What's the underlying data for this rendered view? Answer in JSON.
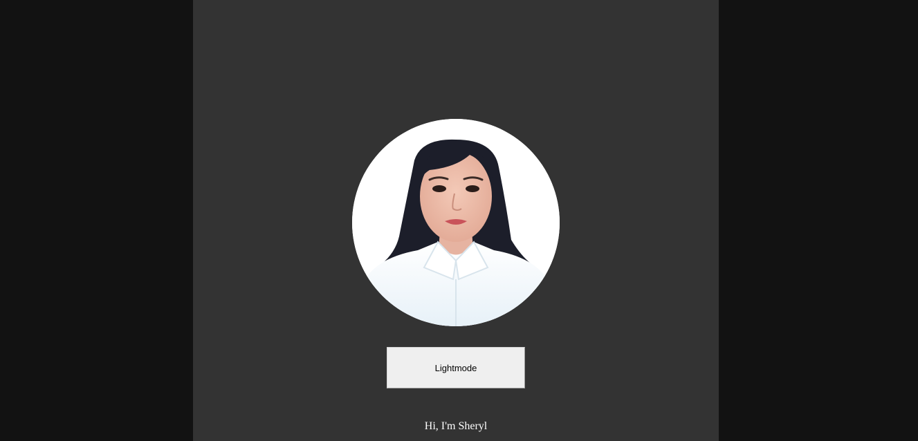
{
  "colors": {
    "outer_background": "#121212",
    "panel_background": "#333333",
    "button_background": "#efefef",
    "greeting_text": "#ffffff"
  },
  "profile": {
    "photo_icon": "profile-photo",
    "greeting": "Hi, I'm Sheryl"
  },
  "theme_toggle": {
    "label": "Lightmode"
  }
}
